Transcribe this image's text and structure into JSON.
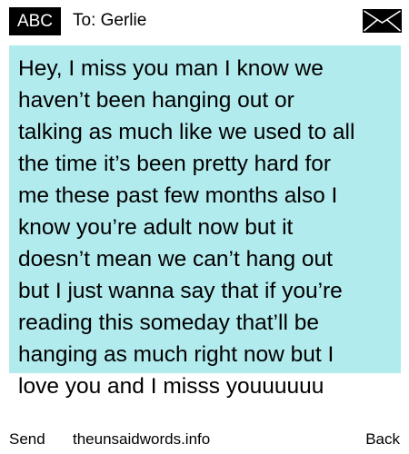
{
  "header": {
    "badge_label": "ABC",
    "recipient_label": "To: Gerlie",
    "envelope_icon": "envelope-icon"
  },
  "message": {
    "highlight_color": "#b2ebee",
    "text": "Hey, I miss you man I know we\nhaven’t been hanging out or\ntalking as much like we used to all\nthe time it’s been pretty hard for\nme these past few months also I\nknow you’re adult now but it\ndoesn’t mean we can’t hang out\nbut I just wanna say that if you’re\nreading this someday that’ll be\nhanging as much right now but I\nlove you and I misss youuuuuu"
  },
  "footer": {
    "send_label": "Send",
    "site_label": "theunsaidwords.info",
    "back_label": "Back"
  }
}
